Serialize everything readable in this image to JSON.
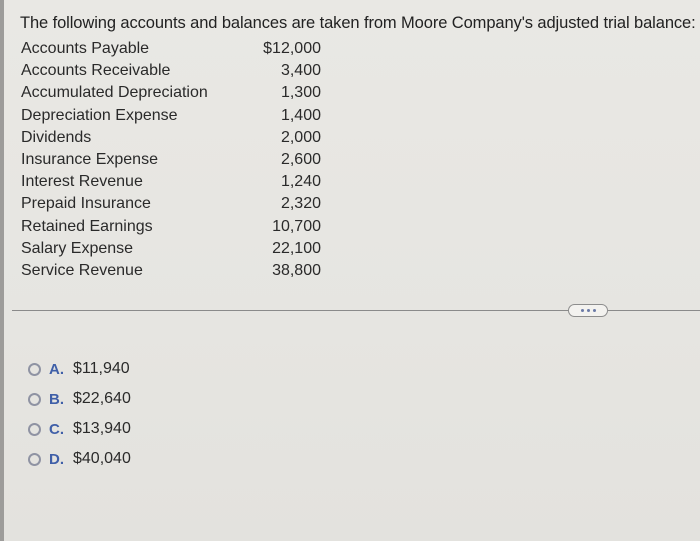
{
  "question": {
    "text": "The following accounts and balances are taken from Moore Company's adjusted trial balance:"
  },
  "accounts": [
    {
      "name": "Accounts Payable",
      "amount": "$12,000"
    },
    {
      "name": "Accounts Receivable",
      "amount": "3,400"
    },
    {
      "name": "Accumulated Depreciation",
      "amount": "1,300"
    },
    {
      "name": "Depreciation Expense",
      "amount": "1,400"
    },
    {
      "name": "Dividends",
      "amount": "2,000"
    },
    {
      "name": "Insurance Expense",
      "amount": "2,600"
    },
    {
      "name": "Interest Revenue",
      "amount": "1,240"
    },
    {
      "name": "Prepaid Insurance",
      "amount": "2,320"
    },
    {
      "name": "Retained Earnings",
      "amount": "10,700"
    },
    {
      "name": "Salary Expense",
      "amount": "22,100"
    },
    {
      "name": "Service Revenue",
      "amount": "38,800"
    }
  ],
  "more_button": {
    "icon": "ellipsis-icon"
  },
  "options": [
    {
      "letter": "A.",
      "value": "$11,940",
      "selected": false
    },
    {
      "letter": "B.",
      "value": "$22,640",
      "selected": false
    },
    {
      "letter": "C.",
      "value": "$13,940",
      "selected": false
    },
    {
      "letter": "D.",
      "value": "$40,040",
      "selected": false
    }
  ],
  "colors": {
    "option_letter": "#3f5fa8",
    "radio_border": "#8f93a3",
    "background": "#e7e6e2"
  }
}
